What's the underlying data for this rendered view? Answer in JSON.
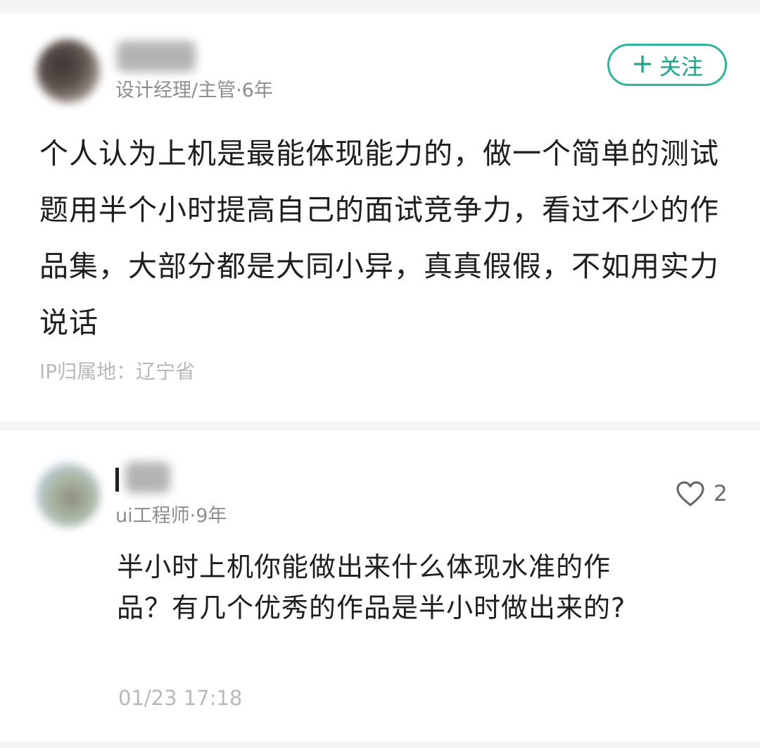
{
  "post": {
    "author_title": "设计经理/主管·6年",
    "follow_button": {
      "icon": "plus-icon",
      "plus": "+",
      "label": "关注"
    },
    "body": "个人认为上机是最能体现能力的，做一个简单的测试题用半个小时提高自己的面试竞争力，看过不少的作品集，大部分都是大同小异，真真假假，不如用实力说话",
    "ip_location": "IP归属地：辽宁省"
  },
  "reply": {
    "author_title": "ui工程师·9年",
    "like": {
      "icon": "heart-icon",
      "count": "2"
    },
    "body": "半小时上机你能做出来什么体现水准的作品？有几个优秀的作品是半小时做出来的?",
    "timestamp": "01/23 17:18"
  },
  "colors": {
    "accent": "#2fb59b",
    "text_primary": "#1f1f1f",
    "text_meta": "#8e8e8e",
    "text_muted": "#b8b8b8",
    "separator": "#f4f5f7"
  }
}
